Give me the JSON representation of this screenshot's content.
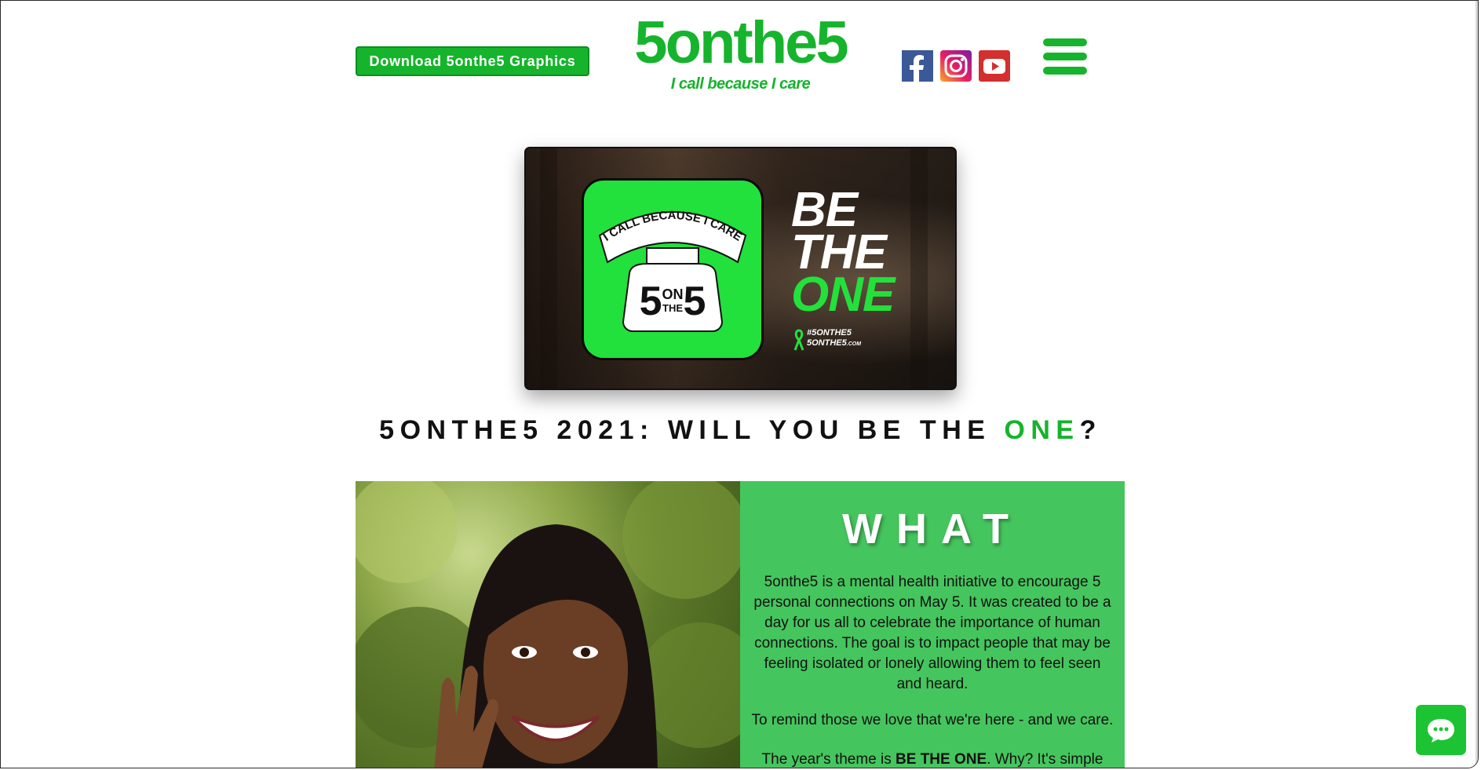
{
  "header": {
    "download_button": "Download 5onthe5 Graphics",
    "logo_title": "5onthe5",
    "logo_tagline": "I call because I care",
    "brand_color": "#16b42c",
    "social_icons": [
      "facebook-icon",
      "instagram-icon",
      "youtube-icon"
    ],
    "menu_icon": "hamburger-menu-icon"
  },
  "hero": {
    "icon_arc_text": "I CALL BECAUSE I CARE",
    "icon_number_left": "5",
    "icon_on": "ON",
    "icon_the": "THE",
    "icon_number_right": "5",
    "be": "BE",
    "the": "THE",
    "one": "ONE",
    "hashtag": "#5ONTHE5",
    "site": "5ONTHE5",
    "site_suffix": ".COM",
    "accent_color": "#23e13b"
  },
  "headline": {
    "prefix": "5onthe5 2021: Will you be the ",
    "highlight": "ONE",
    "suffix": "?"
  },
  "what_section": {
    "title": "WHAT",
    "paragraph_1": "5onthe5 is a mental health initiative to encourage 5 personal connections on May 5. It was created to be a day for us all to celebrate the importance of human connections. The goal is to impact people that may be feeling isolated or lonely allowing them to feel seen and heard.",
    "paragraph_2": "To remind those we love that we're here - and we care.",
    "paragraph_3_prefix": "The year's theme is ",
    "paragraph_3_bold": "BE THE ONE",
    "paragraph_3_suffix": ". Why? It's simple",
    "panel_color": "#45c55e"
  },
  "chat": {
    "icon": "chat-bubble-icon"
  }
}
